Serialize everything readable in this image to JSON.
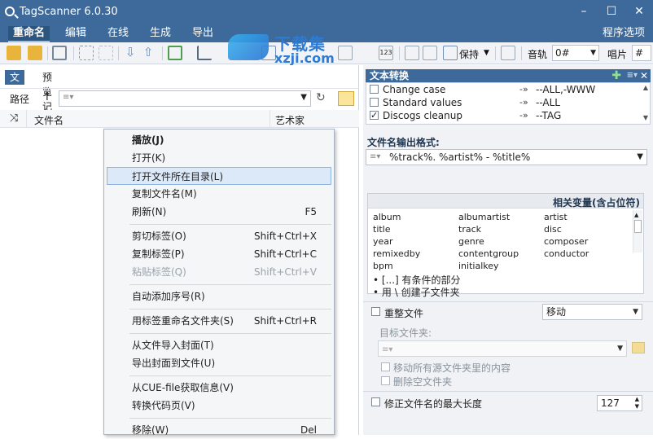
{
  "window": {
    "title": "TagScanner 6.0.30"
  },
  "menubar": {
    "items": [
      "重命名",
      "编辑",
      "在线",
      "生成",
      "导出"
    ],
    "right": "程序选项"
  },
  "toolbar": {
    "keep_label": "保持",
    "track_label": "音轨",
    "track_value": "0#",
    "disc_label": "唱片",
    "disc_value": "#"
  },
  "watermark": {
    "line1": "下载集",
    "line2": "xzji.com"
  },
  "left": {
    "tabs": [
      "文件",
      "预览记录"
    ],
    "path_label": "路径",
    "columns": [
      "文件名",
      "艺术家"
    ]
  },
  "context_menu": {
    "items": [
      {
        "label": "播放(J)",
        "shortcut": "",
        "bold": true,
        "disabled": false,
        "highlight": false
      },
      {
        "label": "打开(K)",
        "shortcut": "",
        "bold": false,
        "disabled": false,
        "highlight": false
      },
      {
        "label": "打开文件所在目录(L)",
        "shortcut": "",
        "bold": false,
        "disabled": false,
        "highlight": true
      },
      {
        "label": "复制文件名(M)",
        "shortcut": "",
        "bold": false,
        "disabled": false,
        "highlight": false
      },
      {
        "label": "刷新(N)",
        "shortcut": "F5",
        "bold": false,
        "disabled": false,
        "highlight": false
      },
      {
        "label": "剪切标签(O)",
        "shortcut": "Shift+Ctrl+X",
        "bold": false,
        "disabled": false,
        "highlight": false
      },
      {
        "label": "复制标签(P)",
        "shortcut": "Shift+Ctrl+C",
        "bold": false,
        "disabled": false,
        "highlight": false
      },
      {
        "label": "粘贴标签(Q)",
        "shortcut": "Shift+Ctrl+V",
        "bold": false,
        "disabled": true,
        "highlight": false
      },
      {
        "label": "自动添加序号(R)",
        "shortcut": "",
        "bold": false,
        "disabled": false,
        "highlight": false
      },
      {
        "label": "用标签重命名文件夹(S)",
        "shortcut": "Shift+Ctrl+R",
        "bold": false,
        "disabled": false,
        "highlight": false
      },
      {
        "label": "从文件导入封面(T)",
        "shortcut": "",
        "bold": false,
        "disabled": false,
        "highlight": false
      },
      {
        "label": "导出封面到文件(U)",
        "shortcut": "",
        "bold": false,
        "disabled": false,
        "highlight": false
      },
      {
        "label": "从CUE-file获取信息(V)",
        "shortcut": "",
        "bold": false,
        "disabled": false,
        "highlight": false
      },
      {
        "label": "转换代码页(V)",
        "shortcut": "",
        "bold": false,
        "disabled": false,
        "highlight": false
      },
      {
        "label": "移除(W)",
        "shortcut": "Del",
        "bold": false,
        "disabled": false,
        "highlight": false
      }
    ]
  },
  "right": {
    "text_conversion": {
      "title": "文本转换",
      "rows": [
        {
          "label": "Change case",
          "value": "--ALL,-WWW",
          "checked": false
        },
        {
          "label": "Standard values",
          "value": "--ALL",
          "checked": false
        },
        {
          "label": "Discogs cleanup",
          "value": "--TAG",
          "checked": true
        }
      ]
    },
    "format_label": "文件名输出格式:",
    "format_value": "%track%. %artist% - %title%",
    "vars_title": "相关变量(含占位符)",
    "vars": [
      "album",
      "albumartist",
      "artist",
      "title",
      "track",
      "disc",
      "year",
      "genre",
      "composer",
      "remixedby",
      "contentgroup",
      "conductor",
      "bpm",
      "initialkey",
      ""
    ],
    "hint1": "• [...] 有条件的部分",
    "hint2": "• 用 \\ 创建子文件夹",
    "reorg_label": "重整文件",
    "reorg_mode": "移动",
    "target_label": "目标文件夹:",
    "move_all_label": "移动所有源文件夹里的内容",
    "delete_empty_label": "删除空文件夹",
    "maxlen_label": "修正文件名的最大长度",
    "maxlen_value": "127"
  }
}
